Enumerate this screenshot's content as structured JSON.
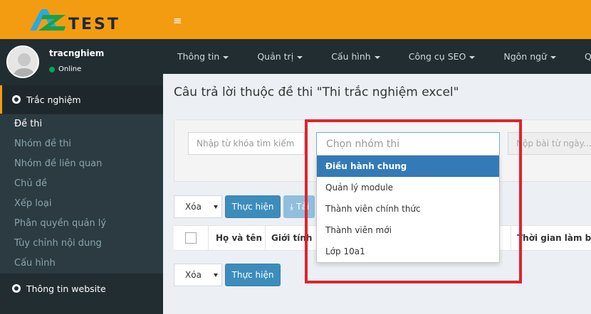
{
  "app": {
    "logo_text": "TEST",
    "hamburger": "≡"
  },
  "user": {
    "name": "tracnghiem",
    "status": "Online",
    "status_color": "#00a65a"
  },
  "sidebar": {
    "section_main": "Trắc nghiệm",
    "items": [
      {
        "label": "Đề thi",
        "active": true
      },
      {
        "label": "Nhóm đề thi"
      },
      {
        "label": "Nhóm đề liên quan"
      },
      {
        "label": "Chủ đề"
      },
      {
        "label": "Xếp loại"
      },
      {
        "label": "Phân quyền quản lý"
      },
      {
        "label": "Tùy chỉnh nội dung"
      },
      {
        "label": "Cấu hình"
      }
    ],
    "section_web": "Thông tin website"
  },
  "navbar": {
    "items": [
      "Thông tin",
      "Quản trị",
      "Cấu hình",
      "Công cụ SEO",
      "Ngôn ngữ",
      "Quản lý Modules"
    ]
  },
  "page": {
    "title": "Câu trả lời thuộc đề thi \"Thi trắc nghiệm excel\""
  },
  "filter": {
    "keyword_placeholder": "Nhập từ khóa tìm kiếm",
    "group_placeholder": "Chọn nhóm thi",
    "date_placeholder": "Nộp bài từ ngày..."
  },
  "dropdown": {
    "options": [
      "Điều hành chung",
      "Quản lý module",
      "Thành viên chính thức",
      "Thành viên mới",
      "Lớp 10a1"
    ],
    "selected_index": 0
  },
  "actions": {
    "select_value": "Xóa",
    "execute_label": "Thực hiện",
    "import_label": "Tải"
  },
  "table": {
    "headers": [
      "Họ và tên",
      "Giới tính",
      "Thời gian làm bài"
    ]
  },
  "colors": {
    "accent": "#f39c12",
    "primary": "#3c8dbc",
    "highlight": "#e0232d"
  }
}
